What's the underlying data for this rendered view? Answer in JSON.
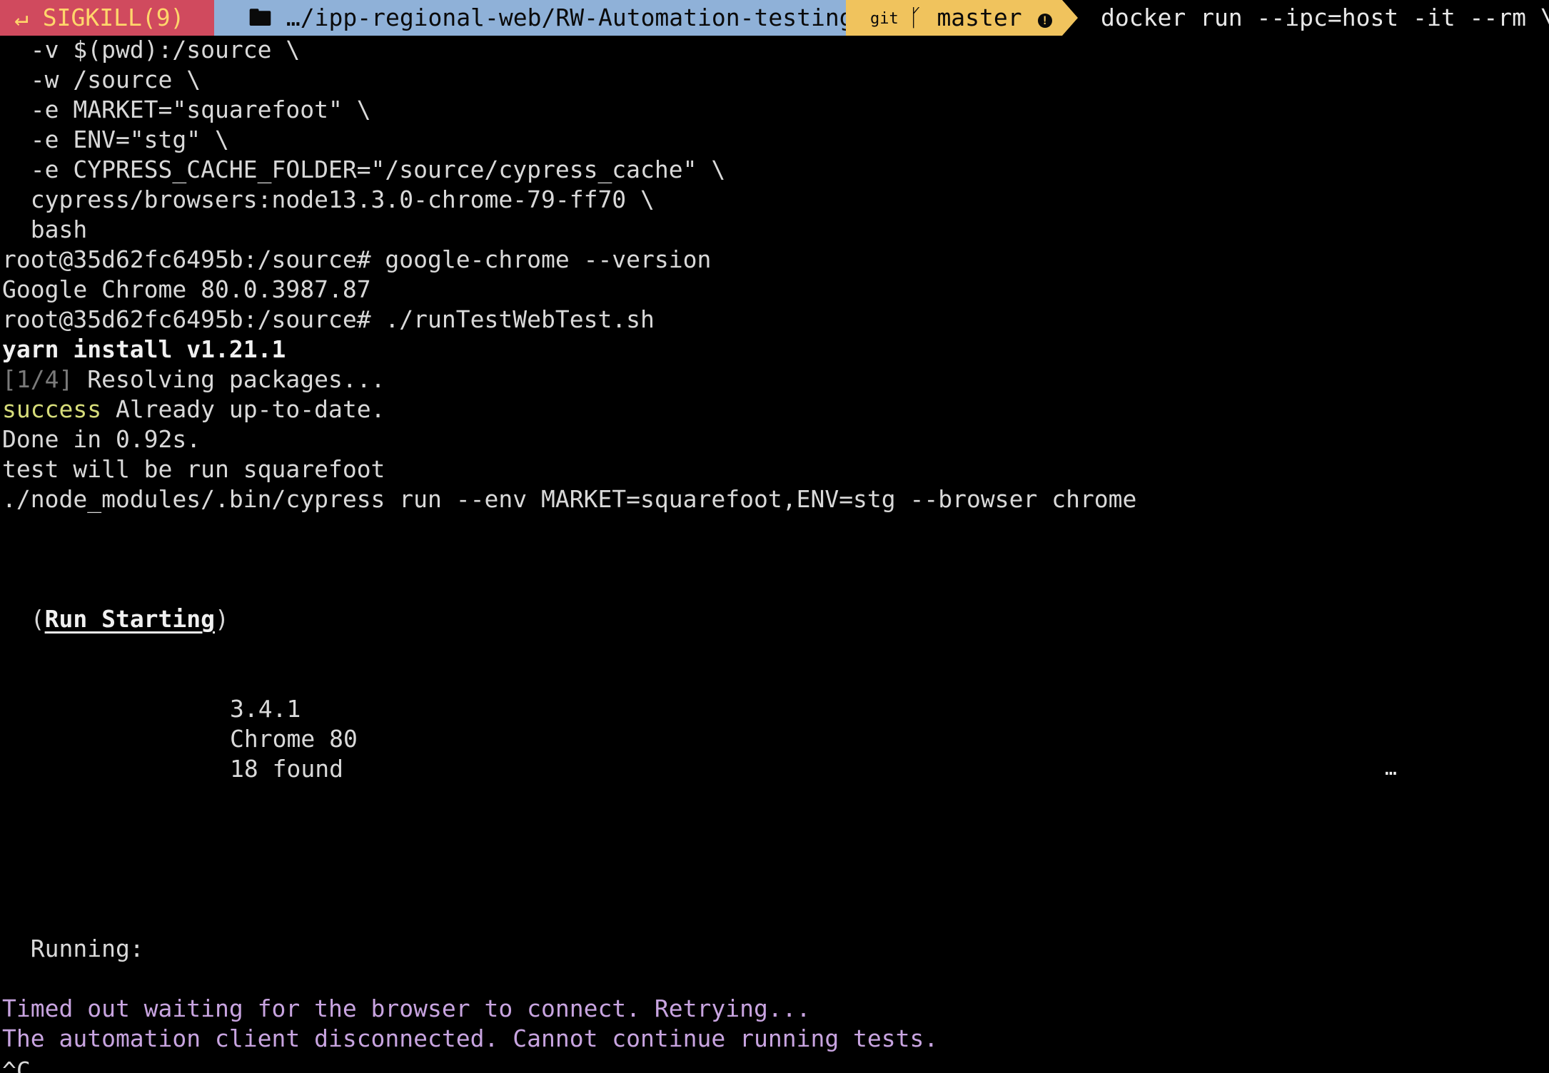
{
  "prompt": {
    "status": "SIGKILL(9)",
    "status_icon": "return-arrow-icon",
    "path": "…/ipp-regional-web/RW-Automation-testing",
    "path_icon": "folder-icon",
    "git_label": "git",
    "branch": "master",
    "branch_icon": "branch-icon",
    "warning_icon": "warning-icon",
    "command": "docker run --ipc=host -it --rm \\"
  },
  "colors": {
    "status_bg": "#d04a5e",
    "status_fg": "#ffd66b",
    "path_bg": "#8fb1d8",
    "git_bg": "#f0c35d",
    "success": "#d7dd7a",
    "error": "#c8a4e0"
  },
  "lines": {
    "l1": "  -v $(pwd):/source \\",
    "l2": "  -w /source \\",
    "l3": "  -e MARKET=\"squarefoot\" \\",
    "l4": "  -e ENV=\"stg\" \\",
    "l5": "  -e CYPRESS_CACHE_FOLDER=\"/source/cypress_cache\" \\",
    "l6": "  cypress/browsers:node13.3.0-chrome-79-ff70 \\",
    "l7": "  bash",
    "l8": "root@35d62fc6495b:/source# google-chrome --version",
    "l9": "Google Chrome 80.0.3987.87",
    "l10": "root@35d62fc6495b:/source# ./runTestWebTest.sh",
    "l11": "yarn install v1.21.1",
    "l12_step": "[1/4]",
    "l12_text": " Resolving packages...",
    "l13_success": "success",
    "l13_text": " Already up-to-date.",
    "l14": "Done in 0.92s.",
    "l15": "test will be run squarefoot",
    "l16": "./node_modules/.bin/cypress run --env MARKET=squarefoot,ENV=stg --browser chrome",
    "run_open": "  (",
    "run_title": "Run Starting",
    "run_close": ")",
    "cypress_version": "3.4.1",
    "browser": "Chrome 80",
    "specs": "18 found",
    "ellipsis": "…",
    "running": "  Running:",
    "error1": "Timed out waiting for the browser to connect. Retrying...",
    "error2": "The automation client disconnected. Cannot continue running tests.",
    "interrupt": "^C"
  }
}
